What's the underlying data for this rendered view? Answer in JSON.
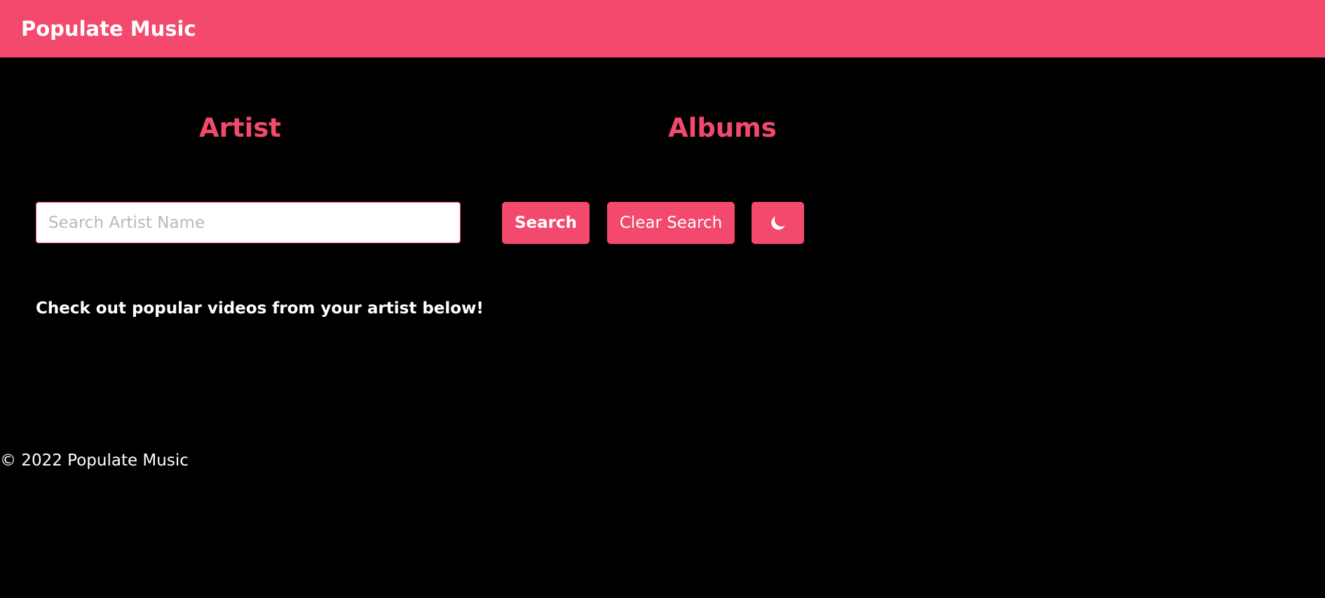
{
  "header": {
    "title": "Populate Music",
    "background": "#f2496c"
  },
  "sections": {
    "artist_heading": "Artist",
    "albums_heading": "Albums"
  },
  "search": {
    "placeholder": "Search Artist Name",
    "value": "",
    "search_label": "Search",
    "clear_label": "Clear Search",
    "theme_toggle_icon": "moon-icon"
  },
  "main": {
    "message": "Check out popular videos from your artist below!"
  },
  "footer": {
    "text": "© 2022 Populate Music"
  },
  "colors": {
    "accent": "#f2496c",
    "background": "#000000",
    "text": "#ffffff"
  }
}
